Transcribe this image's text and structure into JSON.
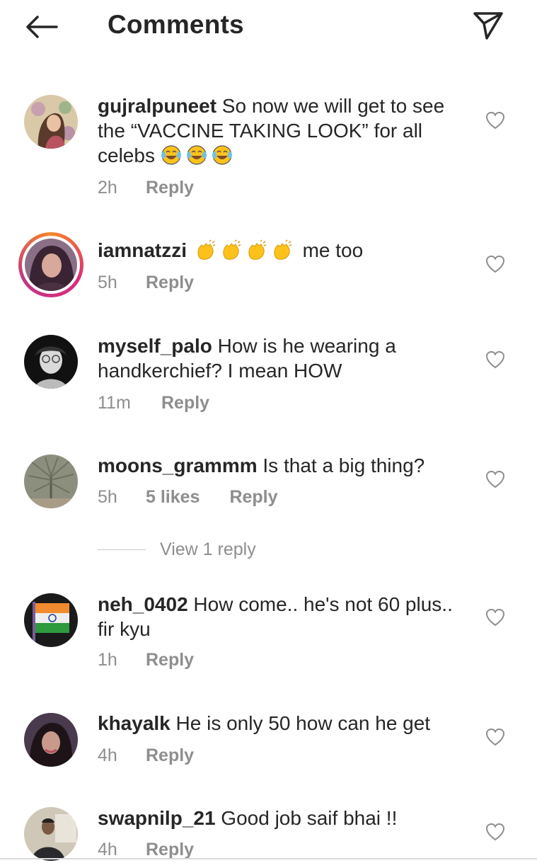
{
  "header": {
    "title": "Comments",
    "back_icon": "arrow-left-icon",
    "share_icon": "paper-plane-icon"
  },
  "comments": [
    {
      "username": "gujralpuneet",
      "text": "So now we will get to see the “VACCINE TAKING LOOK” for all celebs",
      "emoji": [
        "laughing-crying-emoji",
        "laughing-crying-emoji",
        "laughing-crying-emoji"
      ],
      "time": "2h",
      "reply": "Reply"
    },
    {
      "username": "iamnatzzi",
      "text": "me too",
      "emoji": [
        "clapping-hands-emoji",
        "clapping-hands-emoji",
        "clapping-hands-emoji",
        "clapping-hands-emoji"
      ],
      "time": "5h",
      "reply": "Reply"
    },
    {
      "username": "myself_palo",
      "text": "How is he wearing a handkerchief? I mean HOW",
      "time": "11m",
      "reply": "Reply"
    },
    {
      "username": "moons_grammm",
      "text": "Is that a big thing?",
      "time": "5h",
      "likes": "5 likes",
      "reply": "Reply",
      "view_replies": "View 1 reply"
    },
    {
      "username": "neh_0402",
      "text": "How come.. he's not 60 plus.. fir kyu",
      "time": "1h",
      "reply": "Reply"
    },
    {
      "username": "khayalk",
      "text": "He is only 50 how can he get",
      "time": "4h",
      "reply": "Reply"
    },
    {
      "username": "swapnilp_21",
      "text": "Good job saif bhai !!",
      "time": "4h",
      "reply": "Reply"
    }
  ],
  "colors": {
    "text": "#262626",
    "muted": "#8e8e8e",
    "story_ring": "#dd2a7b"
  }
}
